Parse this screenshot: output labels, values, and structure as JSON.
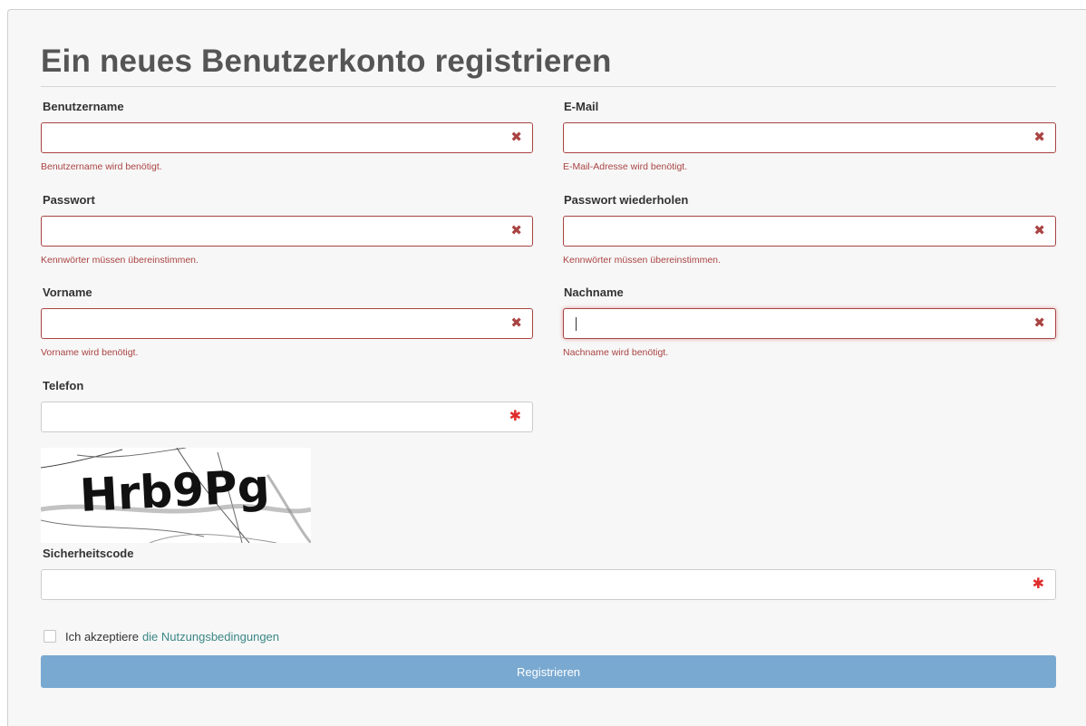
{
  "page": {
    "title": "Ein neues Benutzerkonto registrieren"
  },
  "form": {
    "username": {
      "label": "Benutzername",
      "value": "",
      "error": "Benutzername wird benötigt.",
      "status_icon": "error-x-icon",
      "status_glyph": "✖"
    },
    "email": {
      "label": "E-Mail",
      "value": "",
      "error": "E-Mail-Adresse wird benötigt.",
      "status_icon": "error-x-icon",
      "status_glyph": "✖"
    },
    "password": {
      "label": "Passwort",
      "value": "",
      "error": "Kennwörter müssen übereinstimmen.",
      "status_icon": "error-x-icon",
      "status_glyph": "✖"
    },
    "password_repeat": {
      "label": "Passwort wiederholen",
      "value": "",
      "error": "Kennwörter müssen übereinstimmen.",
      "status_icon": "error-x-icon",
      "status_glyph": "✖"
    },
    "first_name": {
      "label": "Vorname",
      "value": "",
      "error": "Vorname wird benötigt.",
      "status_icon": "error-x-icon",
      "status_glyph": "✖"
    },
    "last_name": {
      "label": "Nachname",
      "value": "",
      "error": "Nachname wird benötigt.",
      "status_icon": "error-x-icon",
      "status_glyph": "✖",
      "focused": true
    },
    "phone": {
      "label": "Telefon",
      "value": "",
      "status_icon": "required-asterisk-icon",
      "status_glyph": "✱"
    },
    "captcha": {
      "image_text": "Hrb9Pg"
    },
    "security_code": {
      "label": "Sicherheitscode",
      "value": "",
      "status_icon": "required-asterisk-icon",
      "status_glyph": "✱"
    },
    "terms": {
      "checked": false,
      "prefix": "Ich akzeptiere",
      "link_text": "die Nutzungsbedingungen"
    },
    "submit_label": "Registrieren"
  },
  "colors": {
    "error": "#a94442",
    "required": "#e02b2b",
    "button": "#79a9d1",
    "link": "#3b8686",
    "panel_bg": "#f7f7f7"
  }
}
